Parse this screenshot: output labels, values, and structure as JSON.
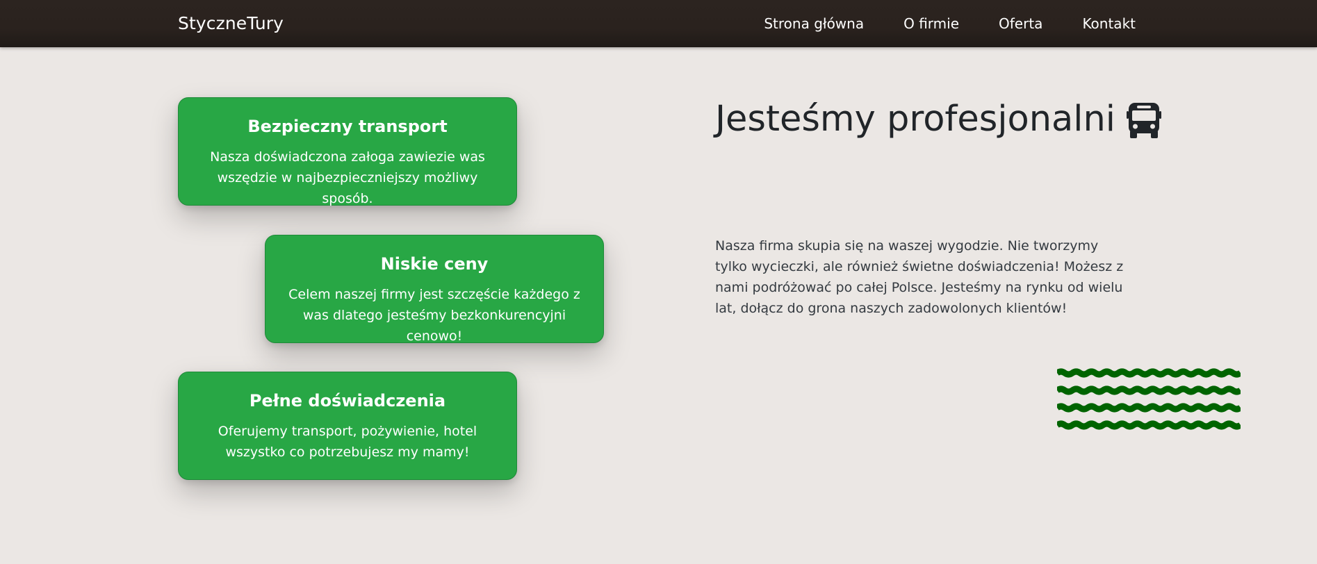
{
  "brand": "StyczneTury",
  "nav": {
    "items": [
      "Strona główna",
      "O firmie",
      "Oferta",
      "Kontakt"
    ]
  },
  "cards": [
    {
      "title": "Bezpieczny transport",
      "text": "Nasza doświadczona załoga zawiezie was wszędzie w najbezpieczniejszy możliwy sposób."
    },
    {
      "title": "Niskie ceny",
      "text": "Celem naszej firmy jest szczęście każdego z was dlatego jesteśmy bezkonkurencyjni cenowo!"
    },
    {
      "title": "Pełne doświadczenia",
      "text": "Oferujemy transport, pożywienie, hotel wszystko co potrzebujesz my mamy!"
    }
  ],
  "about": {
    "heading": "Jesteśmy profesjonalni",
    "heading_icon": "bus-icon",
    "description": "Nasza firma skupia się na waszej wygodzie. Nie tworzymy tylko wycieczki, ale również świetne doświadczenia! Możesz z nami podróżować po całej Polsce. Jesteśmy na rynku od wielu lat, dołącz do grona naszych zadowolonych klientów!"
  },
  "colors": {
    "card_green": "#28a745",
    "wave_green": "#006400",
    "navbar_dark": "#2a221e",
    "page_background": "#ebe7e4"
  }
}
